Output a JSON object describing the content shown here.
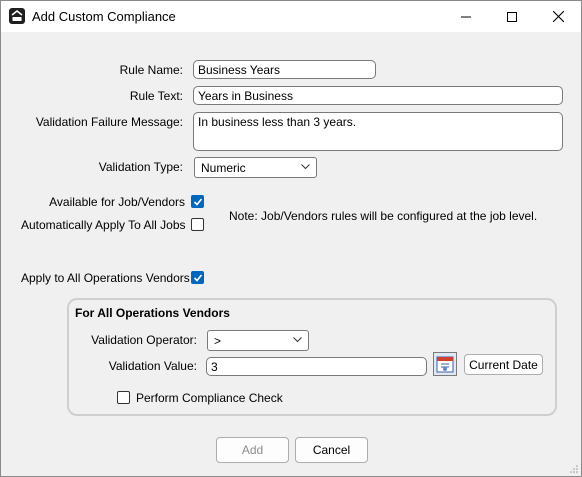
{
  "window": {
    "title": "Add Custom Compliance",
    "icon": "app-logo-icon",
    "controls": [
      "minimize-icon",
      "maximize-icon",
      "close-icon"
    ]
  },
  "form": {
    "rule_name_label": "Rule Name:",
    "rule_name_value": "Business Years",
    "rule_text_label": "Rule Text:",
    "rule_text_value": "Years in Business",
    "failure_message_label": "Validation Failure Message:",
    "failure_message_value": "In business less than 3 years.",
    "validation_type_label": "Validation Type:",
    "validation_type_value": "Numeric",
    "available_label": "Available for Job/Vendors",
    "available_checked": true,
    "auto_apply_label": "Automatically Apply To All Jobs",
    "auto_apply_checked": false,
    "note": "Note:  Job/Vendors rules will be configured at the job level.",
    "apply_ops_label": "Apply to All Operations Vendors",
    "apply_ops_checked": true
  },
  "operations_group": {
    "title": "For All Operations Vendors",
    "operator_label": "Validation Operator:",
    "operator_value": ">",
    "value_label": "Validation Value:",
    "value_value": "3",
    "calendar_icon": "calendar-icon",
    "current_date_label": "Current Date",
    "perform_check_label": "Perform Compliance Check",
    "perform_check_checked": false
  },
  "buttons": {
    "add_label": "Add",
    "cancel_label": "Cancel"
  },
  "colors": {
    "checkbox_accent": "#0067c0",
    "window_bg": "#f0f0f0"
  }
}
